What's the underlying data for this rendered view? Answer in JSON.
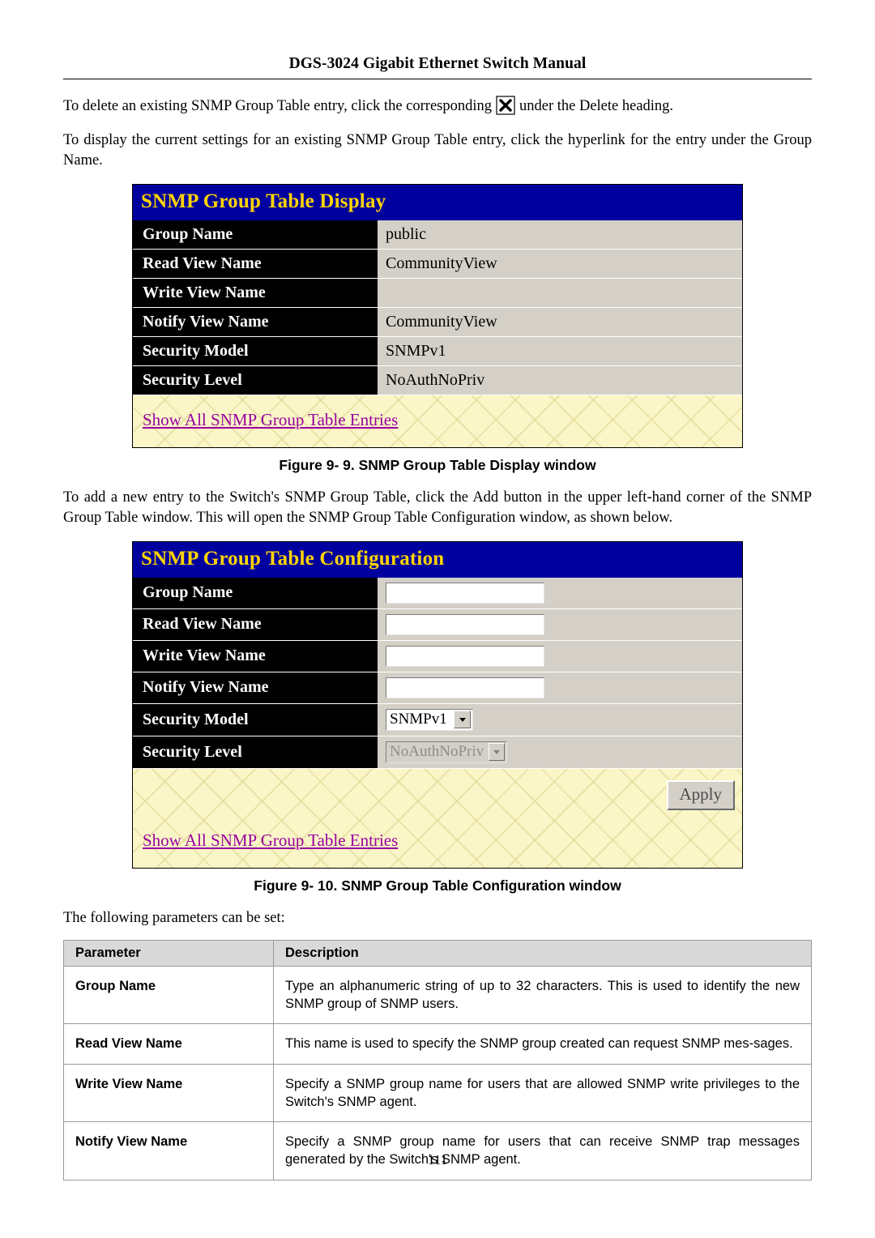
{
  "header": {
    "title": "DGS-3024 Gigabit Ethernet Switch Manual"
  },
  "paragraphs": {
    "delete_before": "To delete an existing SNMP Group Table entry, click the corresponding",
    "delete_after": "under the Delete heading.",
    "display": "To display the current settings for an existing SNMP Group Table entry, click the hyperlink for the entry under the Group Name.",
    "add_entry": "To add a new entry to the Switch's SNMP Group Table, click the Add button in the upper left-hand corner of the SNMP Group Table window. This will open the SNMP Group Table Configuration window, as shown below.",
    "following": "The following parameters can be set:"
  },
  "display_window": {
    "title": "SNMP Group Table Display",
    "rows": [
      {
        "label": "Group Name",
        "value": "public"
      },
      {
        "label": "Read View Name",
        "value": "CommunityView"
      },
      {
        "label": "Write View Name",
        "value": ""
      },
      {
        "label": "Notify View Name",
        "value": "CommunityView"
      },
      {
        "label": "Security Model",
        "value": "SNMPv1"
      },
      {
        "label": "Security Level",
        "value": "NoAuthNoPriv"
      }
    ],
    "link": "Show All SNMP Group Table Entries",
    "caption": "Figure 9- 9. SNMP Group Table Display window"
  },
  "config_window": {
    "title": "SNMP Group Table Configuration",
    "rows": [
      {
        "label": "Group Name",
        "value": ""
      },
      {
        "label": "Read View Name",
        "value": ""
      },
      {
        "label": "Write View Name",
        "value": ""
      },
      {
        "label": "Notify View Name",
        "value": ""
      }
    ],
    "security_model": {
      "label": "Security Model",
      "value": "SNMPv1"
    },
    "security_level": {
      "label": "Security Level",
      "value": "NoAuthNoPriv"
    },
    "apply_label": "Apply",
    "link": "Show All SNMP Group Table Entries",
    "caption": "Figure 9- 10. SNMP Group Table Configuration window"
  },
  "param_table": {
    "headers": {
      "parameter": "Parameter",
      "description": "Description"
    },
    "rows": [
      {
        "parameter": "Group Name",
        "description": "Type an alphanumeric string of up to 32 characters. This is used to identify the new SNMP group of SNMP users."
      },
      {
        "parameter": "Read View Name",
        "description": "This name is used to specify the SNMP group created can request SNMP mes-sages."
      },
      {
        "parameter": "Write View Name",
        "description": "Specify a SNMP group name for users that are allowed SNMP write privileges to the Switch's SNMP agent."
      },
      {
        "parameter": "Notify View Name",
        "description": "Specify a SNMP group name for users that can receive SNMP trap messages generated by the Switch's SNMP agent."
      }
    ]
  },
  "page_number": "111"
}
